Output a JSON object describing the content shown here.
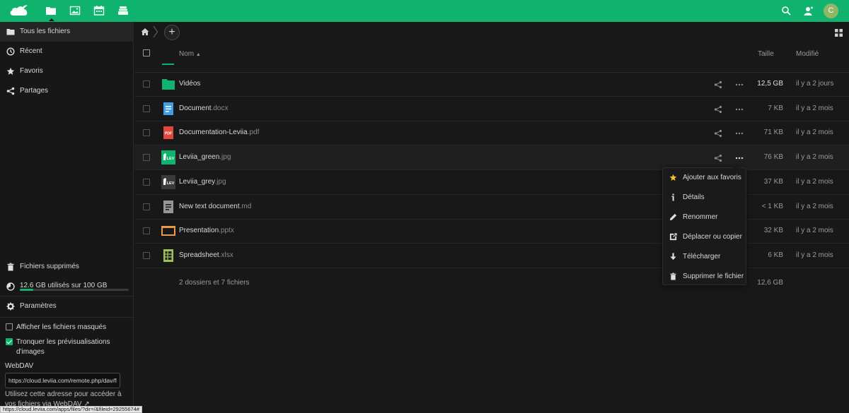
{
  "header": {
    "apps": [
      {
        "name": "files",
        "icon": "folder-icon"
      },
      {
        "name": "photos",
        "icon": "image-icon"
      },
      {
        "name": "calendar",
        "icon": "calendar-icon"
      },
      {
        "name": "deck",
        "icon": "stack-icon"
      }
    ],
    "avatar_letter": "C"
  },
  "sidebar": {
    "nav": [
      {
        "label": "Tous les fichiers",
        "icon": "folder-icon",
        "active": true
      },
      {
        "label": "Récent",
        "icon": "clock-icon"
      },
      {
        "label": "Favoris",
        "icon": "star-icon"
      },
      {
        "label": "Partages",
        "icon": "share-icon"
      }
    ],
    "trash_label": "Fichiers supprimés",
    "quota_label": "12.6 GB utilisés sur 100 GB",
    "quota_fraction": 0.126,
    "settings_label": "Paramètres",
    "show_hidden_label": "Afficher les fichiers masqués",
    "show_hidden_checked": false,
    "crop_previews_label": "Tronquer les prévisualisations d'images",
    "crop_previews_checked": true,
    "webdav_title": "WebDAV",
    "webdav_url": "https://cloud.leviia.com/remote.php/dav/fi",
    "webdav_help": "Utilisez cette adresse pour accéder à vos fichiers via WebDAV ↗"
  },
  "table": {
    "col_name": "Nom",
    "col_size": "Taille",
    "col_modified": "Modifié",
    "rows": [
      {
        "name": "Vidéos",
        "ext": "",
        "type": "folder",
        "size": "12,5 GB",
        "modified": "il y a 2 jours"
      },
      {
        "name": "Document",
        "ext": ".docx",
        "type": "docx",
        "size": "7 KB",
        "modified": "il y a 2 mois"
      },
      {
        "name": "Documentation-Leviia",
        "ext": ".pdf",
        "type": "pdf",
        "size": "71 KB",
        "modified": "il y a 2 mois"
      },
      {
        "name": "Leviia_green",
        "ext": ".jpg",
        "type": "img-green",
        "size": "76 KB",
        "modified": "il y a 2 mois"
      },
      {
        "name": "Leviia_grey",
        "ext": ".jpg",
        "type": "img-grey",
        "size": "37 KB",
        "modified": "il y a 2 mois"
      },
      {
        "name": "New text document",
        "ext": ".md",
        "type": "text",
        "size": "< 1 KB",
        "modified": "il y a 2 mois"
      },
      {
        "name": "Presentation",
        "ext": ".pptx",
        "type": "pptx",
        "size": "32 KB",
        "modified": "il y a 2 mois"
      },
      {
        "name": "Spreadsheet",
        "ext": ".xlsx",
        "type": "xlsx",
        "size": "6 KB",
        "modified": "il y a 2 mois"
      }
    ],
    "summary": "2 dossiers et 7 fichiers",
    "summary_size": "12,6 GB",
    "pdf_badge": "PDF",
    "img_badge": "LEV"
  },
  "menu": {
    "items": [
      {
        "label": "Ajouter aux favoris",
        "icon": "star-icon"
      },
      {
        "label": "Détails",
        "icon": "info-icon"
      },
      {
        "label": "Renommer",
        "icon": "pencil-icon"
      },
      {
        "label": "Déplacer ou copier",
        "icon": "move-icon"
      },
      {
        "label": "Télécharger",
        "icon": "download-icon"
      },
      {
        "label": "Supprimer le fichier",
        "icon": "trash-icon"
      }
    ]
  },
  "status_url": "https://cloud.leviia.com/apps/files/?dir=/&fileid=29255674#",
  "colors": {
    "brand": "#0fb36d",
    "background": "#181818",
    "folder": "#0fb36d",
    "docx": "#3e9ee8",
    "pdf": "#e0483b",
    "pptx": "#e99b4c",
    "xlsx": "#9cc05a",
    "star": "#f4c12c"
  }
}
